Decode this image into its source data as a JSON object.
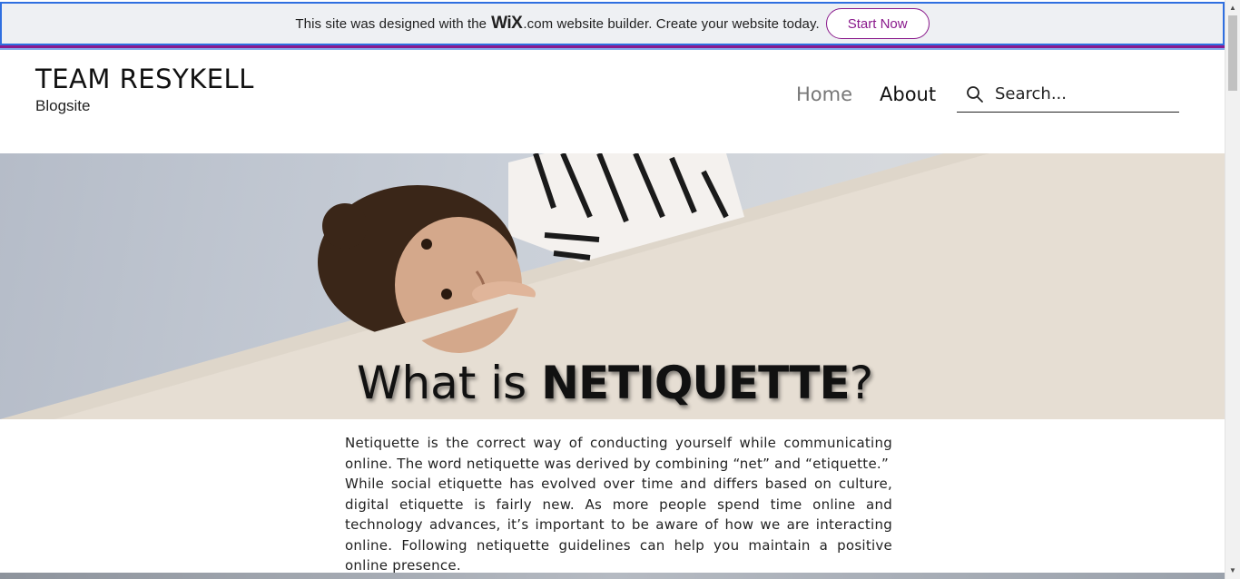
{
  "banner": {
    "text_before": "This site was designed with the",
    "logo": "WiX",
    "text_after": ".com website builder. Create your website today.",
    "cta_label": "Start Now"
  },
  "header": {
    "title": "TEAM RESYKELL",
    "subtitle": "Blogsite",
    "nav": [
      {
        "label": "Home"
      },
      {
        "label": "About"
      }
    ],
    "search_placeholder": "Search..."
  },
  "hero": {
    "title_prefix": "What is ",
    "title_emphasis": "NETIQUETTE",
    "title_suffix": "?"
  },
  "article": {
    "paragraph1": "Netiquette is the correct way of conducting yourself while communicating online. The word netiquette was derived by combining “net” and “etiquette.”",
    "paragraph2": "While social etiquette has evolved over time and differs based on culture, digital etiquette is fairly new. As more people spend time online and technology advances, it’s important to be aware of how we are interacting online. Following netiquette guidelines can help you maintain a positive online presence."
  },
  "colors": {
    "accent": "#8a1a8c",
    "focus_outline": "#2f6fe0",
    "nav_active": "#777777"
  }
}
